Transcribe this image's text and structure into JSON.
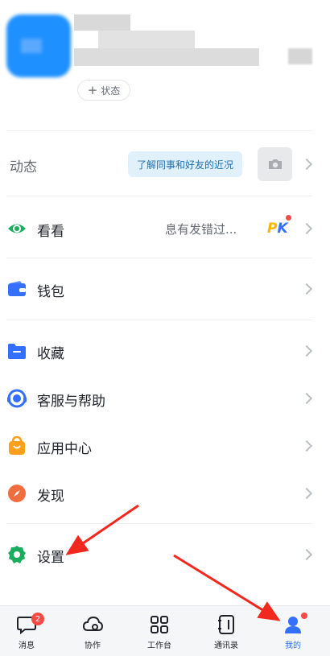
{
  "header": {
    "status_label": "状态"
  },
  "moments": {
    "label": "动态",
    "tip": "了解同事和好友的近况"
  },
  "menu": {
    "kankan": {
      "label": "看看",
      "subtitle": "息有发错过...",
      "badge": "PK"
    },
    "wallet": {
      "label": "钱包"
    },
    "favorites": {
      "label": "收藏"
    },
    "support": {
      "label": "客服与帮助"
    },
    "app_center": {
      "label": "应用中心"
    },
    "discover": {
      "label": "发现"
    },
    "settings": {
      "label": "设置"
    }
  },
  "tabbar": {
    "messages": {
      "label": "消息",
      "badge": "2"
    },
    "collab": {
      "label": "协作"
    },
    "workbench": {
      "label": "工作台"
    },
    "contacts": {
      "label": "通讯录"
    },
    "me": {
      "label": "我的"
    }
  },
  "colors": {
    "accent": "#3370ff",
    "annotation_arrow": "#f0281e",
    "badge_red": "#f54a45"
  }
}
